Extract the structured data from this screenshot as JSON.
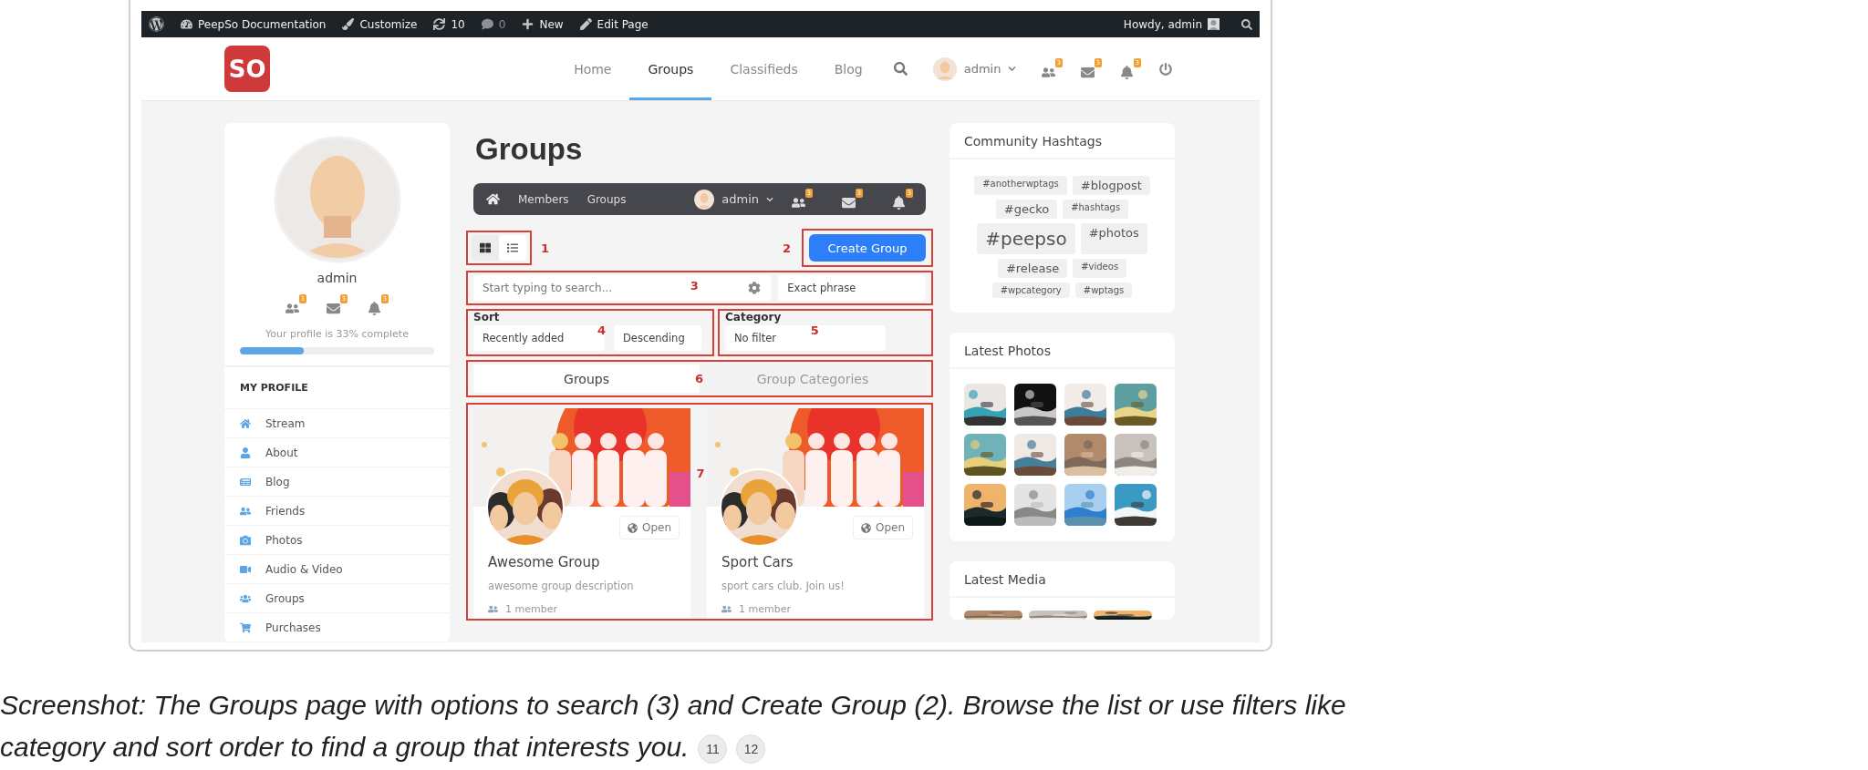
{
  "admin_bar": {
    "items": [
      {
        "kind": "wp-logo"
      },
      {
        "kind": "site",
        "label": "PeepSo Documentation"
      },
      {
        "kind": "customize",
        "label": "Customize"
      },
      {
        "kind": "updates",
        "label": "10"
      },
      {
        "kind": "comments",
        "label": "0"
      },
      {
        "kind": "new",
        "label": "New"
      },
      {
        "kind": "edit",
        "label": "Edit Page"
      }
    ],
    "greeting": "Howdy, admin"
  },
  "header": {
    "logo": "SO",
    "nav": [
      {
        "label": "Home",
        "selected": false
      },
      {
        "label": "Groups",
        "selected": true
      },
      {
        "label": "Classifieds",
        "selected": false
      },
      {
        "label": "Blog",
        "selected": false
      }
    ],
    "user": "admin",
    "badges": [
      "3",
      "3",
      "3"
    ]
  },
  "profile": {
    "name": "admin",
    "badges": [
      "3",
      "3",
      "3"
    ],
    "completion": "Your profile is 33% complete",
    "level": 0.33,
    "menu_title": "MY PROFILE",
    "menu": [
      {
        "kind": "stream",
        "label": "Stream"
      },
      {
        "kind": "about",
        "label": "About"
      },
      {
        "kind": "blog",
        "label": "Blog"
      },
      {
        "kind": "friends",
        "label": "Friends"
      },
      {
        "kind": "photos",
        "label": "Photos"
      },
      {
        "kind": "video",
        "label": "Audio & Video"
      },
      {
        "kind": "groups",
        "label": "Groups"
      },
      {
        "kind": "purchases",
        "label": "Purchases"
      }
    ]
  },
  "page_title": "Groups",
  "subnav": {
    "items": [
      "Members",
      "Groups"
    ],
    "user": "admin",
    "badges": [
      "3",
      "3",
      "3"
    ]
  },
  "view_toggles": [
    {
      "kind": "grid",
      "selected": true
    },
    {
      "kind": "list",
      "selected": false
    }
  ],
  "create_button": "Create Group",
  "search": {
    "placeholder": "Start typing to search...",
    "mode": "Exact phrase"
  },
  "sort": {
    "label": "Sort",
    "order_by": "Recently added",
    "direction": "Descending"
  },
  "category": {
    "label": "Category",
    "value": "No filter"
  },
  "tabs": [
    {
      "label": "Groups",
      "selected": true
    },
    {
      "label": "Group Categories",
      "selected": false
    }
  ],
  "groups": [
    {
      "name": "Awesome Group",
      "description": "awesome group description",
      "privacy": "Open",
      "members": "1 member"
    },
    {
      "name": "Sport Cars",
      "description": "sport cars club. Join us!",
      "privacy": "Open",
      "members": "1 member"
    }
  ],
  "annotations": [
    "1",
    "2",
    "3",
    "4",
    "5",
    "6",
    "7"
  ],
  "hashtags": {
    "title": "Community Hashtags",
    "tags": [
      {
        "label": "#anotherwptags",
        "kind": "small"
      },
      {
        "label": "#blogpost",
        "kind": "medium"
      },
      {
        "label": "#gecko",
        "kind": "medium"
      },
      {
        "label": "#hashtags",
        "kind": "small"
      },
      {
        "label": "#peepso",
        "kind": "large"
      },
      {
        "label": "#photos",
        "kind": "medium"
      },
      {
        "label": "#release",
        "kind": "medium"
      },
      {
        "label": "#videos",
        "kind": "small"
      },
      {
        "label": "#wpcategory",
        "kind": "small"
      },
      {
        "label": "#wptags",
        "kind": "small"
      }
    ]
  },
  "latest_photos": {
    "title": "Latest Photos"
  },
  "latest_media": {
    "title": "Latest Media"
  },
  "caption": {
    "text": "*Screenshot: The Groups page with options to search (3) and Create Group (2). Browse the list or use filters like category and sort order to find a group that interests you.*",
    "footnotes": [
      "11",
      "12"
    ]
  }
}
